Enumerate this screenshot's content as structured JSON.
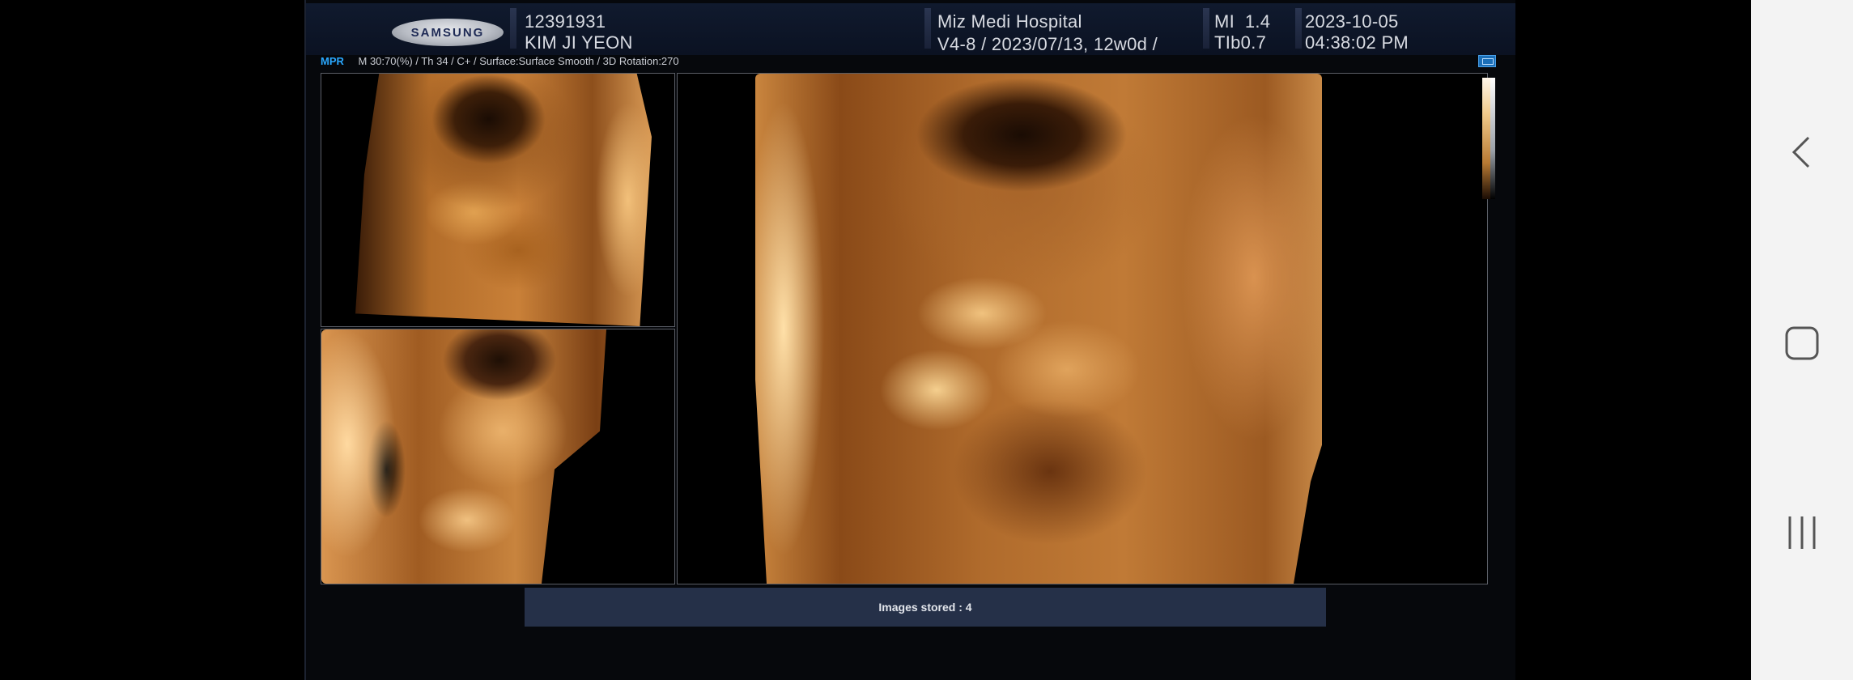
{
  "header": {
    "brand": "SAMSUNG",
    "patient_id": "12391931",
    "patient_name": "KIM JI YEON",
    "hospital": "Miz Medi Hospital",
    "probe_info": "V4-8 / 2023/07/13, 12w0d /",
    "mi": "MI  1.4",
    "tib": "TIb0.7",
    "date": "2023-10-05",
    "time": "04:38:02 PM"
  },
  "info_line": {
    "mode": "MPR",
    "params": "M 30:70(%) / Th 34 / C+ / Surface:Surface Smooth / 3D Rotation:270"
  },
  "status": {
    "text": "Images stored : 4"
  },
  "icons": {
    "layout": "layout-icon",
    "cursor": "mouse-pointer-icon",
    "back": "back-chevron-icon",
    "home": "home-square-icon",
    "recents": "recents-lines-icon"
  },
  "colors": {
    "screen_bg": "#06080c",
    "header_bg": "#101a2e",
    "accent": "#2aa8ff",
    "render_tone": "#c9853e",
    "status_bg": "#253048",
    "nav_bg": "#f3f3f3"
  }
}
